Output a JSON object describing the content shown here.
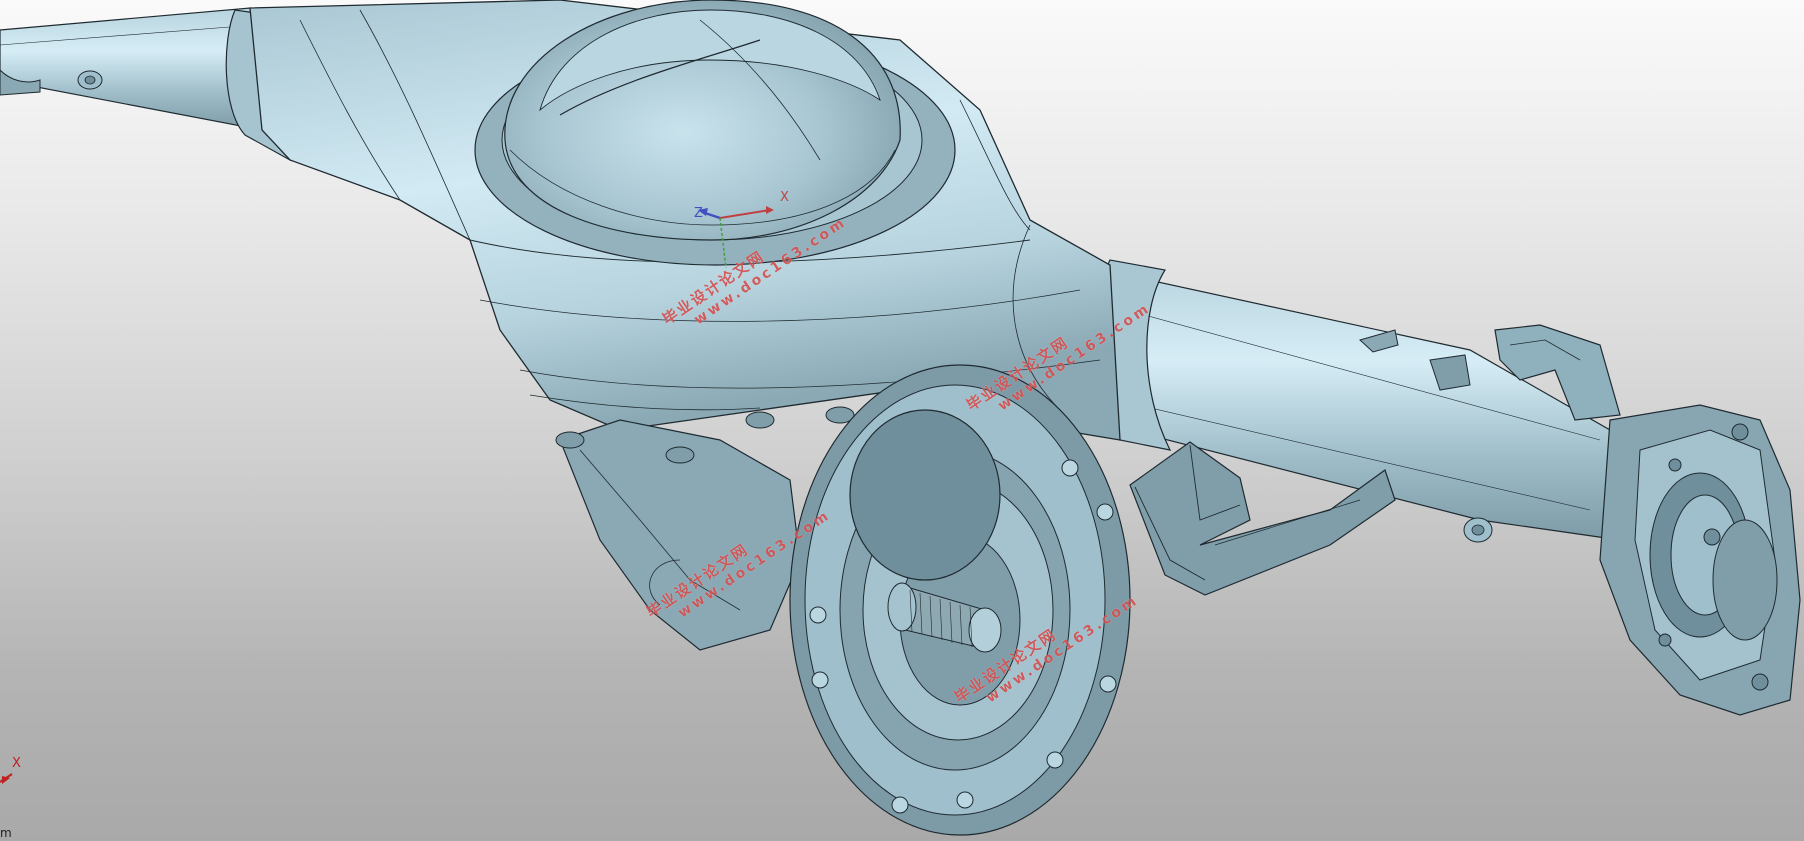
{
  "viewport": {
    "background_top": "#fafafa",
    "background_bottom": "#a9a9a9",
    "model_color": "#9fbfcc",
    "model_highlight": "#cbe7f2",
    "model_shadow": "#6f8f9c",
    "edge_color": "#1f2a30"
  },
  "watermarks": [
    {
      "cn": "毕业设计论文网",
      "url": "www.doc163.com"
    },
    {
      "cn": "毕业设计论文网",
      "url": "www.doc163.com"
    },
    {
      "cn": "毕业设计论文网",
      "url": "www.doc163.com"
    },
    {
      "cn": "毕业设计论文网",
      "url": "www.doc163.com"
    }
  ],
  "center_triad": {
    "x_label": "X",
    "z_label": "Z"
  },
  "corner_triad": {
    "x_label": "X"
  },
  "unit_label": "m"
}
